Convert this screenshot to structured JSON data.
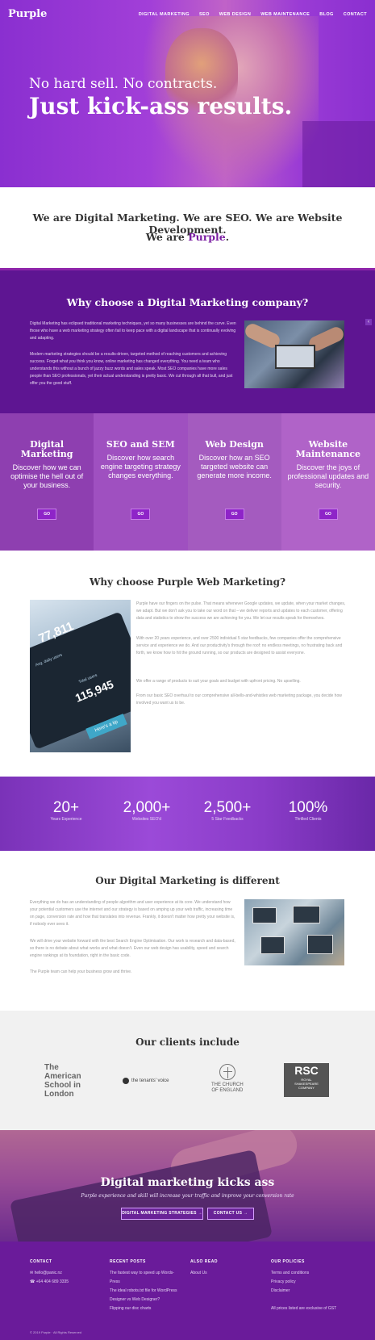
{
  "header": {
    "logo": "Purple",
    "nav": [
      "DIGITAL MARKETING",
      "SEO",
      "WEB DESIGN",
      "WEB MAINTENANCE",
      "BLOG",
      "CONTACT"
    ]
  },
  "hero": {
    "line1": "No hard sell. No contracts.",
    "line2": "Just kick-ass results."
  },
  "intro": {
    "line1": "We are Digital Marketing. We are SEO. We are Website Development.",
    "line2_prefix": "We are ",
    "line2_accent": "Purple",
    "line2_suffix": "."
  },
  "why": {
    "title": "Why choose a Digital Marketing company?",
    "p1": "Digital Marketing has eclipsed traditional marketing techniques, yet so many businesses are behind the curve. Even those who have a web marketing strategy often fail to keep pace with a digital landscape that is continually evolving and adapting.",
    "p2": "Modern marketing strategies should be a results-driven, targeted method of reaching customers and achieving success. Forget what you think you know, online marketing has changed everything. You need a team who understands this without a bunch of jazzy buzz words and sales speak. Most SEO companies have more sales people than SEO professionals, yet their actual understanding is pretty basic. We cut through all that bull, and just offer you the good stuff.",
    "side_arrow": "‹"
  },
  "services": [
    {
      "title": "Digital Marketing",
      "desc": "Discover how we can optimise the hell out of your business.",
      "button": "GO",
      "bg": "#8e3fb0"
    },
    {
      "title": "SEO and SEM",
      "desc": "Discover how search engine targeting strategy changes everything.",
      "button": "GO",
      "bg": "#9f50c0"
    },
    {
      "title": "Web Design",
      "desc": "Discover how an SEO targeted website can generate more income.",
      "button": "GO",
      "bg": "#a45bbf"
    },
    {
      "title": "Website Maintenance",
      "desc": "Discover the joys of professional updates and security.",
      "button": "GO",
      "bg": "#b063c8"
    }
  ],
  "pwm": {
    "title": "Why choose Purple Web Marketing?",
    "phone_n1": "77,811",
    "phone_n2": "115,945",
    "phone_l1": "Avg. daily users",
    "phone_l2": "Total users",
    "phone_btn": "Here's a tip",
    "p1": "Purple have our fingers on the pulse. That means whenever Google updates, we update, when your market changes, we adapt. But we don't ask you to take our word on that – we deliver reports and updates to each customer, offering data and statistics to show the success we are achieving for you. We let our results speak for themselves.",
    "p2": "With over 20 years experience, and over 2500 individual 5 star feedbacks, few companies offer the comprehensive service and experience we do. And our productivity's through the roof: no endless meetings, no frustrating back and forth, we know how to hit the ground running, so our products are designed to assist everyone.",
    "p3": "We offer a range of products to suit your goals and budget with upfront pricing. No upselling.",
    "p4": "From our basic SEO overhaul to our comprehensive all-bells-and-whistles web marketing package, you decide how involved you want us to be."
  },
  "stats": [
    {
      "value": "20+",
      "label": "Years Experience"
    },
    {
      "value": "2,000+",
      "label": "Websites SEO'd"
    },
    {
      "value": "2,500+",
      "label": "5 Star Feedbacks"
    },
    {
      "value": "100%",
      "label": "Thrilled Clients"
    }
  ],
  "different": {
    "title": "Our Digital Marketing is different",
    "p1": "Everything we do has an understanding of people algorithm and user experience at its core. We understand how your potential customers use the internet and our strategy is based on amping up your web traffic, increasing time on page, conversion rate and how that translates into revenue. Frankly, it doesn't matter how pretty your website is, if nobody ever sees it.",
    "p2": "We will drive your website forward with the best Search Engine Optimisation. Our work is research and data-based, so there is no debate about what works and what doesn't. Even our web design has usability, speed and search engine rankings at its foundation, right in the basic code.",
    "p3": "The Purple team can help your business grow and thrive."
  },
  "clients": {
    "title": "Our clients include",
    "school": [
      "The",
      "American",
      "School in",
      "London"
    ],
    "tenants": "the tenants' voice",
    "church": [
      "THE CHURCH",
      "OF ENGLAND"
    ],
    "rsc_big": "RSC",
    "rsc_small": [
      "ROYAL",
      "SHAKESPEARE",
      "COMPANY"
    ]
  },
  "cta": {
    "title": "Digital marketing kicks ass",
    "subtitle": "Purple experience and skill will increase your traffic and improve your conversion rate",
    "btn1": "DIGITAL MARKETING STRATEGIES →",
    "btn2": "CONTACT US →"
  },
  "footer": {
    "contact_h": "CONTACT",
    "contact": [
      "✉ hello@panic.nz",
      "☎ +64 404 689 3335"
    ],
    "recent_h": "RECENT POSTS",
    "recent": [
      "The fastest way to speed up Words-",
      "Press",
      "The ideal robots.txt file for WordPress",
      "Designer vs Web Designer?",
      "Flipping our disc charts"
    ],
    "also_h": "ALSO READ",
    "also": [
      "About Us"
    ],
    "policies_h": "OUR POLICIES",
    "policies": [
      "Terms and conditions",
      "Privacy policy",
      "Disclaimer",
      "",
      "All prices listed are exclusive of GST"
    ],
    "copyright": "© 2019 Purple · All Rights Reserved"
  },
  "colors": {
    "accent": "#7b1fa2",
    "dark_purple": "#5e1592",
    "footer": "#6a1b9a"
  }
}
